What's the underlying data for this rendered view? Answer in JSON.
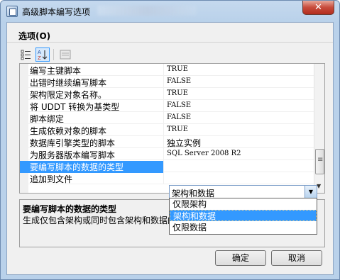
{
  "window": {
    "title": "高级脚本编写选项",
    "close_glyph": "✕"
  },
  "panel": {
    "heading": "选项(O)"
  },
  "toolbar": {
    "icons": [
      "categorized-icon",
      "alphabetical-icon",
      "property-pages-icon"
    ]
  },
  "properties": [
    {
      "name": "编写主键脚本",
      "value": "TRUE"
    },
    {
      "name": "出错时继续编写脚本",
      "value": "FALSE"
    },
    {
      "name": "架构限定对象名称。",
      "value": "TRUE"
    },
    {
      "name": "将 UDDT 转换为基类型",
      "value": "FALSE"
    },
    {
      "name": "脚本绑定",
      "value": "FALSE"
    },
    {
      "name": "生成依赖对象的脚本",
      "value": "TRUE"
    },
    {
      "name": "数据库引擎类型的脚本",
      "value": "独立实例"
    },
    {
      "name": "为服务器版本编写脚本",
      "value": "SQL Server 2008 R2"
    },
    {
      "name": "要编写脚本的数据的类型",
      "value": ""
    },
    {
      "name": "追加到文件",
      "value": ""
    }
  ],
  "combo": {
    "value": "架构和数据"
  },
  "dropdown": {
    "options": [
      "仅限架构",
      "架构和数据",
      "仅限数据"
    ],
    "selected_index": 1
  },
  "description": {
    "title": "要编写脚本的数据的类型",
    "text": "生成仅包含架构或同时包含架构和数据的脚本。"
  },
  "buttons": {
    "ok": "确定",
    "cancel": "取消"
  }
}
